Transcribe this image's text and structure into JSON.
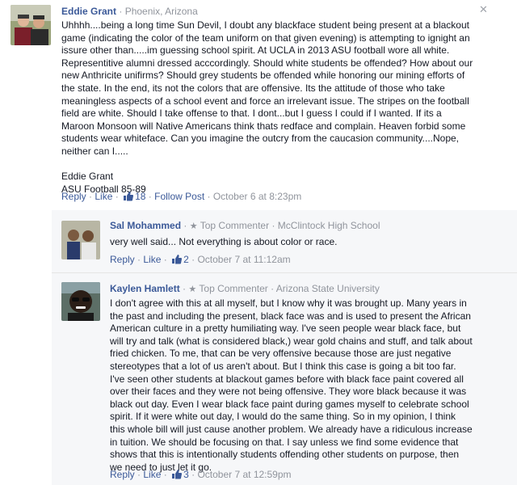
{
  "close_icon": "close-icon",
  "comments": [
    {
      "author": "Eddie Grant",
      "separator": "·",
      "meta": "Phoenix, Arizona",
      "body_lines": [
        "Uhhhh....being a long time Sun Devil, I doubt any blackface student being present at a blackout",
        "game (indicating the color of the team uniform on that given evening) is attempting to ignight an",
        "issure other than.....im guessing school spirit. At UCLA in 2013 ASU football wore all white.",
        "Representitive alumni dressed acccordingly. Should white students be offended? How about our",
        "new Anthricite unifirms? Should grey students be offended while honoring our mining efforts of",
        "the state. In the end, its not the colors that are offensive. Its the attitude of those who take",
        "meaningless aspects of a school event and force an irrelevant issue. The stripes on the football",
        "field are white. Should I take offense to that. I dont...but I guess I could if I wanted. If its a",
        "Maroon Monsoon will Native Americans think thats redface and complain. Heaven forbid some",
        "students wear whiteface. Can you imagine the outcry from the caucasion community....Nope,",
        "neither can I.....",
        "",
        "Eddie Grant",
        "ASU Football 85-89"
      ],
      "actions": {
        "reply": "Reply",
        "like": "Like",
        "likes": "18",
        "follow": "Follow Post",
        "time": "October 6 at 8:23pm"
      }
    }
  ],
  "replies": [
    {
      "author": "Sal Mohammed",
      "separator": "·",
      "badge": "Top Commenter",
      "affiliation": "McClintock High School",
      "body_lines": [
        "very well said... Not everything is about color or race."
      ],
      "actions": {
        "reply": "Reply",
        "like": "Like",
        "likes": "2",
        "time": "October 7 at 11:12am"
      }
    },
    {
      "author": "Kaylen Hamlett",
      "separator": "·",
      "badge": "Top Commenter",
      "affiliation": "Arizona State University",
      "body_lines": [
        "I don't agree with this at all myself, but I know why it was brought up. Many years in",
        "the past and including the present, black face was and is used to present the African",
        "American culture in a pretty humiliating way. I've seen people wear black face, but",
        "will try and talk (what is considered black,) wear gold chains and stuff, and talk about",
        "fried chicken. To me, that can be very offensive because those are just negative",
        "stereotypes that a lot of us aren't about. But I think this case is going a bit too far.",
        "I've seen other students at blackout games before with black face paint covered all",
        "over their faces and they were not being offensive. They wore black because it was",
        "black out day. Even I wear black face paint during games myself to celebrate school",
        "spirit. If it were white out day, I would do the same thing. So in my opinion, I think",
        "this whole bill will just cause another problem. We already have a ridiculous increase",
        "in tuition. We should be focusing on that. I say unless we find some evidence that",
        "shows that this is intentionally students offending other students on purpose, then",
        "we need to just let it go."
      ],
      "actions": {
        "reply": "Reply",
        "like": "Like",
        "likes": "3",
        "time": "October 7 at 12:59pm"
      }
    }
  ]
}
